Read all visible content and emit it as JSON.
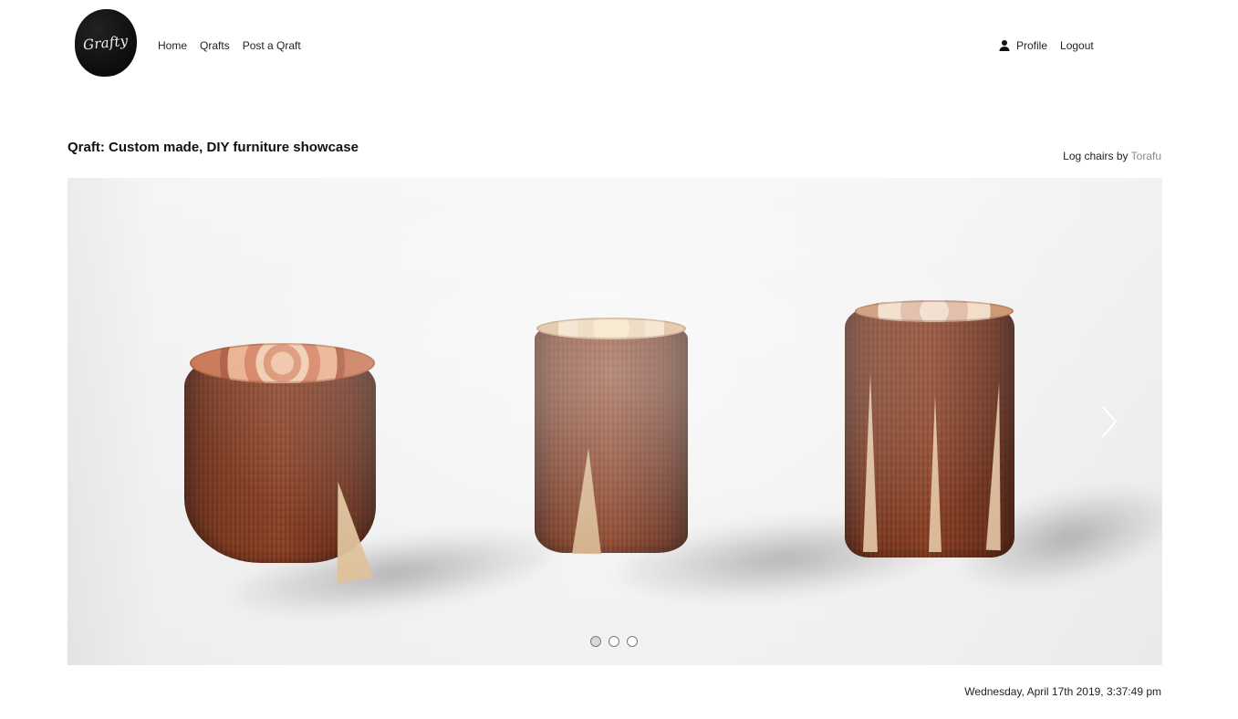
{
  "header": {
    "logo_text": "Grafty",
    "nav_left": [
      "Home",
      "Qrafts",
      "Post a Qraft"
    ],
    "nav_right": {
      "profile": "Profile",
      "logout": "Logout"
    }
  },
  "main": {
    "title": "Qraft: Custom made, DIY furniture showcase",
    "credit_prefix": "Log chairs by",
    "credit_author": "Torafu",
    "timestamp": "Wednesday, April 17th 2019, 3:37:49 pm"
  },
  "carousel": {
    "slide_count": 3,
    "active_index": 0,
    "next_icon": "chevron-right-icon"
  },
  "icons": {
    "profile": "user-icon",
    "next": "chevron-right-icon"
  },
  "colors": {
    "text": "#1f1f1f",
    "credit_author": "#8b8b8b",
    "logo": "#111111"
  }
}
